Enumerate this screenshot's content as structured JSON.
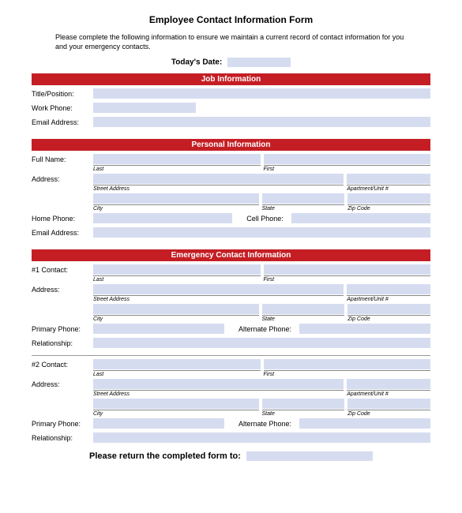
{
  "form": {
    "title": "Employee Contact Information Form",
    "instructions": "Please complete the following information to ensure we maintain a current record of contact information for you and your emergency contacts.",
    "todays_date_label": "Today's Date:",
    "return_label": "Please return the completed form to:"
  },
  "sections": {
    "job": {
      "header": "Job Information",
      "title_position": "Title/Position:",
      "work_phone": "Work Phone:",
      "email": "Email Address:"
    },
    "personal": {
      "header": "Personal Information",
      "full_name": "Full Name:",
      "address": "Address:",
      "home_phone": "Home Phone:",
      "cell_phone": "Cell Phone:",
      "email": "Email Address:"
    },
    "emergency": {
      "header": "Emergency Contact Information",
      "contact1": "#1 Contact:",
      "contact2": "#2 Contact:",
      "address": "Address:",
      "primary_phone": "Primary Phone:",
      "alternate_phone": "Alternate Phone:",
      "relationship": "Relationship:"
    }
  },
  "sublabels": {
    "last": "Last",
    "first": "First",
    "street": "Street Address",
    "apt": "Apartment/Unit #",
    "city": "City",
    "state": "State",
    "zip": "Zip Code"
  }
}
